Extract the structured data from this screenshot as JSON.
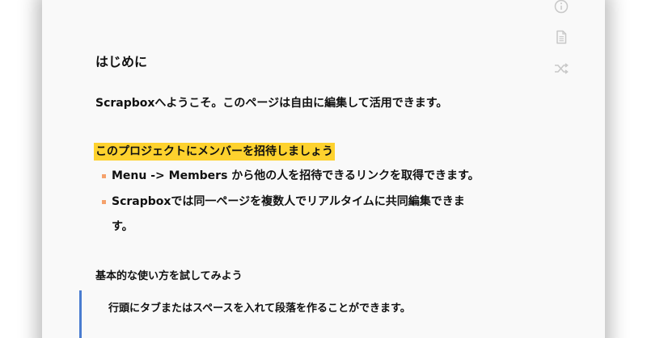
{
  "page": {
    "title": "はじめに",
    "intro": "Scrapboxへようこそ。このページは自由に編集して活用できます。",
    "highlight": "このプロジェクトにメンバーを招待しましょう",
    "bullets": [
      "Menu -> Members から他の人を招待できるリンクを取得できます。",
      "Scrapboxでは同一ページを複数人でリアルタイムに共同編集できま"
    ],
    "bullet2_continuation": "す。",
    "subheading": "基本的な使い方を試してみよう",
    "quote": "行頭にタブまたはスペースを入れて段落を作ることができます。"
  },
  "side_icons": [
    "info-icon",
    "document-icon",
    "shuffle-icon"
  ],
  "colors": {
    "highlight": "#fed22e",
    "bullet": "#f5a26c",
    "quote_bar": "#4a7cd0",
    "card_bg": "#f9f9f9",
    "icon": "#c8c8c8"
  }
}
